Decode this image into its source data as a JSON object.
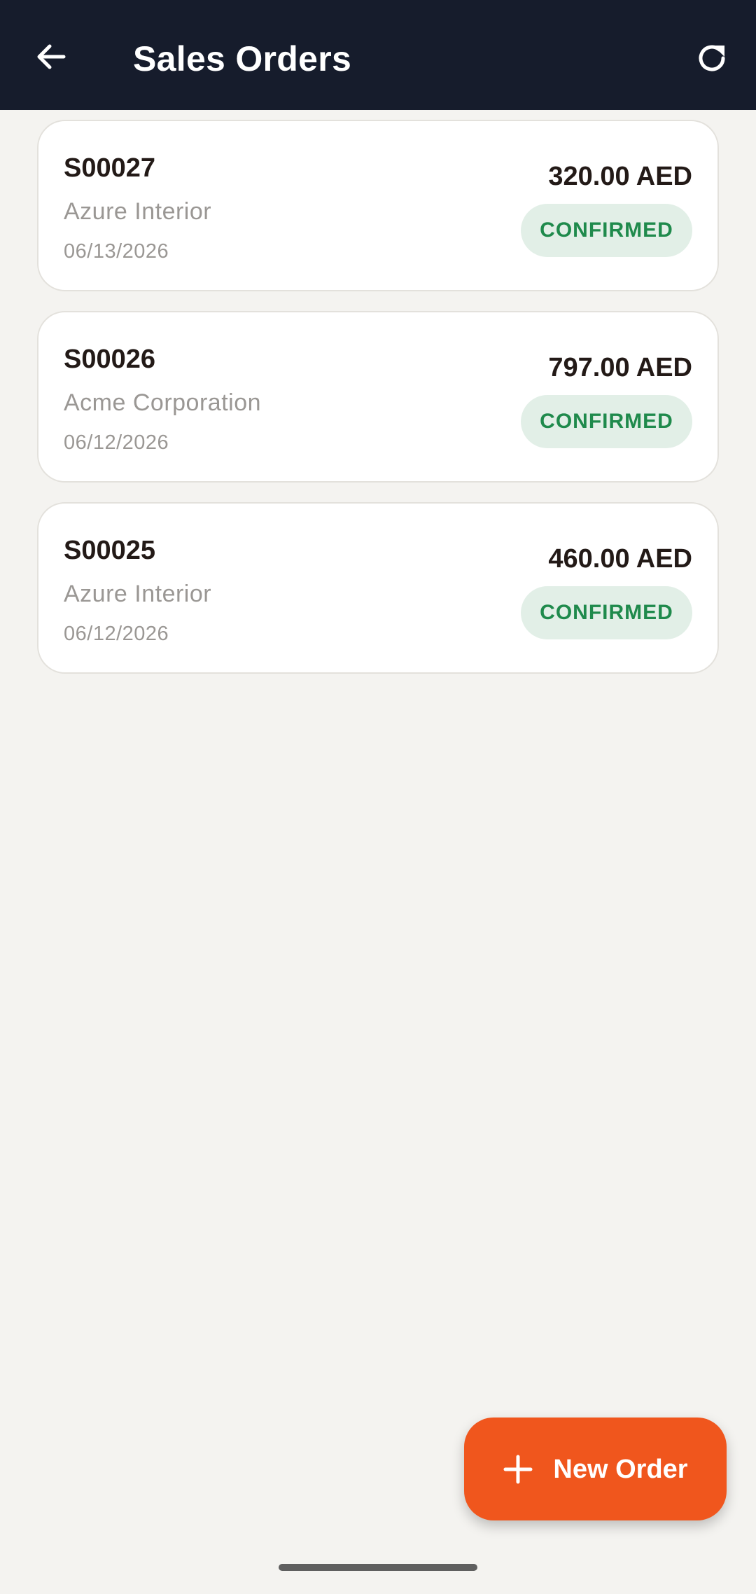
{
  "app_bar": {
    "title": "Sales Orders",
    "back_icon": "arrow-left-icon",
    "refresh_icon": "refresh-icon"
  },
  "orders": [
    {
      "number": "S00027",
      "customer": "Azure Interior",
      "date": "06/13/2026",
      "amount": "320.00 AED",
      "status": "CONFIRMED"
    },
    {
      "number": "S00026",
      "customer": "Acme Corporation",
      "date": "06/12/2026",
      "amount": "797.00 AED",
      "status": "CONFIRMED"
    },
    {
      "number": "S00025",
      "customer": "Azure Interior",
      "date": "06/12/2026",
      "amount": "460.00 AED",
      "status": "CONFIRMED"
    }
  ],
  "fab": {
    "label": "New Order",
    "icon": "plus-icon"
  },
  "colors": {
    "app_bar_bg": "#161c2c",
    "accent": "#f0561d",
    "status_confirmed_text": "#1f8a4c",
    "status_confirmed_bg": "#e2efe7"
  }
}
